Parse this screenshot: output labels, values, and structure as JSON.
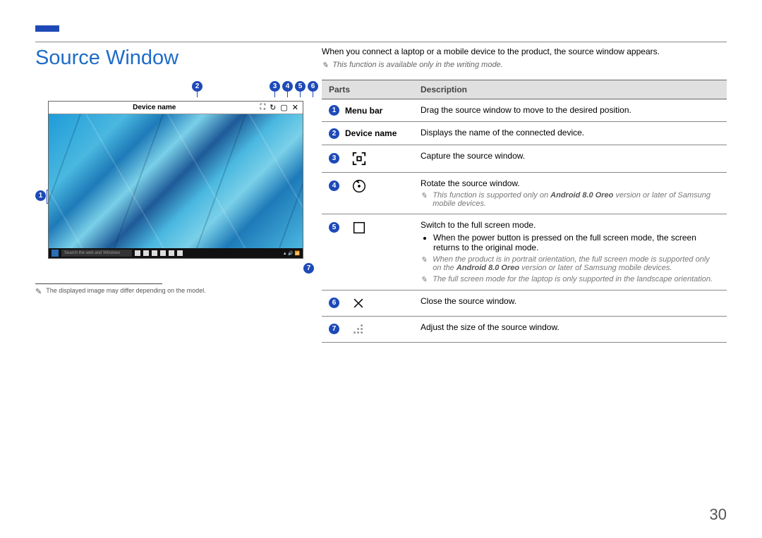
{
  "page_number": "30",
  "title": "Source Window",
  "intro": "When you connect a laptop or a mobile device to the product, the source window appears.",
  "intro_note": "This function is available only in the writing mode.",
  "device_name_label": "Device name",
  "taskbar_search": "Search the web and Windows",
  "footnote": "The displayed image may differ depending on the model.",
  "table": {
    "h_parts": "Parts",
    "h_desc": "Description",
    "rows": {
      "r1": {
        "num": "1",
        "label": "Menu bar",
        "desc": "Drag the source window to move to the desired position."
      },
      "r2": {
        "num": "2",
        "label": "Device name",
        "desc": "Displays the name of the connected device."
      },
      "r3": {
        "num": "3",
        "desc": "Capture the source window."
      },
      "r4": {
        "num": "4",
        "desc": "Rotate the source window.",
        "note_prefix": "This function is supported only on ",
        "bold": "Android 8.0 Oreo",
        "note_suffix": " version or later of Samsung mobile devices."
      },
      "r5": {
        "num": "5",
        "desc": "Switch to the full screen mode.",
        "b1": "When the power button is pressed on the full screen mode, the screen returns to the original mode.",
        "n1a": "When the product is in portrait orientation, the full screen mode is supported only on the ",
        "n1b": "Android 8.0 Oreo",
        "n1c": " version or later of Samsung mobile devices.",
        "n2": "The full screen mode for the laptop is only supported in the landscape orientation."
      },
      "r6": {
        "num": "6",
        "desc": "Close the source window."
      },
      "r7": {
        "num": "7",
        "desc": "Adjust the size of the source window."
      }
    }
  },
  "callouts": {
    "c1": "1",
    "c2": "2",
    "c3": "3",
    "c4": "4",
    "c5": "5",
    "c6": "6",
    "c7": "7"
  }
}
